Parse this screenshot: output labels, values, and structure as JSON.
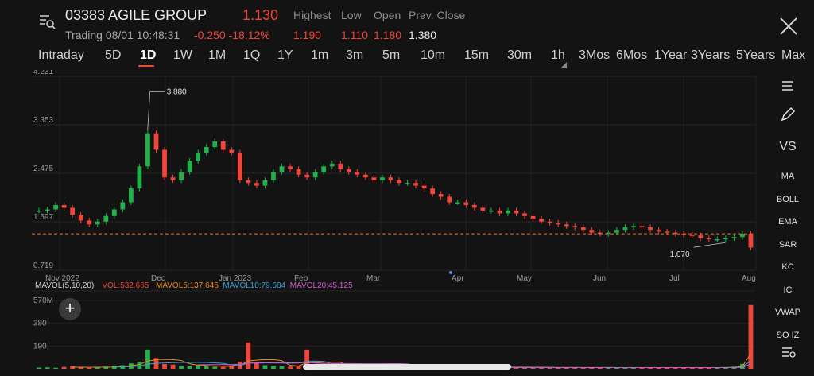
{
  "header": {
    "title": "03383 AGILE GROUP",
    "price": "1.130",
    "status": "Trading 08/01 10:48:31",
    "change": "-0.250  -18.12%",
    "stats": [
      {
        "label": "Highest",
        "value": "1.190"
      },
      {
        "label": "Low",
        "value": "1.110"
      },
      {
        "label": "Open",
        "value": "1.180"
      },
      {
        "label": "Prev. Close",
        "value": "1.380"
      }
    ]
  },
  "tabs": [
    "Intraday",
    "5D",
    "1D",
    "1W",
    "1M",
    "1Q",
    "1Y",
    "1m",
    "3m",
    "5m",
    "10m",
    "15m",
    "30m",
    "1h",
    "3Mos",
    "6Mos",
    "1Year",
    "3Years",
    "5Years",
    "Max"
  ],
  "active_tab": "1D",
  "tools": [
    "MA",
    "BOLL",
    "EMA",
    "SAR",
    "KC",
    "IC",
    "VWAP",
    "SO IZ"
  ],
  "tool_icons": [
    "list-lines-icon",
    "pencil-icon"
  ],
  "vs_label": "VS",
  "colors": {
    "up": "#22b04a",
    "down": "#f0453a",
    "prev_close": "#ef6a1a"
  },
  "chart_data": {
    "type": "candlestick",
    "y_ticks": [
      "4.231",
      "3.353",
      "2.475",
      "1.597",
      "0.719"
    ],
    "ylim": [
      0.719,
      4.231
    ],
    "x_ticks": [
      "Nov 2022",
      "Dec",
      "Jan 2023",
      "Feb",
      "Mar",
      "Apr",
      "May",
      "Jun",
      "Jul",
      "Aug"
    ],
    "high_label": "3.880",
    "low_label": "1.070",
    "prev_close": 1.38,
    "close_points": [
      1.8,
      1.82,
      1.9,
      1.85,
      1.72,
      1.62,
      1.55,
      1.6,
      1.7,
      1.82,
      1.95,
      2.2,
      2.6,
      3.2,
      2.9,
      2.4,
      2.35,
      2.5,
      2.7,
      2.85,
      2.95,
      3.05,
      2.9,
      2.85,
      2.35,
      2.3,
      2.25,
      2.35,
      2.5,
      2.6,
      2.55,
      2.45,
      2.4,
      2.5,
      2.6,
      2.65,
      2.55,
      2.5,
      2.45,
      2.4,
      2.35,
      2.4,
      2.35,
      2.3,
      2.3,
      2.25,
      2.2,
      2.1,
      2.05,
      1.95,
      1.95,
      1.9,
      1.85,
      1.8,
      1.8,
      1.75,
      1.8,
      1.75,
      1.7,
      1.65,
      1.6,
      1.58,
      1.55,
      1.52,
      1.5,
      1.45,
      1.4,
      1.38,
      1.4,
      1.45,
      1.5,
      1.52,
      1.5,
      1.45,
      1.42,
      1.4,
      1.38,
      1.36,
      1.35,
      1.3,
      1.28,
      1.28,
      1.3,
      1.32,
      1.38,
      1.13
    ],
    "volume": {
      "legend": [
        "MAVOL(5,10,20)",
        "VOL:532.665",
        "MAVOL5:137.645",
        "MAVOL10:79.684",
        "MAVOL20:45.125"
      ],
      "legend_colors": [
        "#d0d0d0",
        "#f0453a",
        "#ef8a1a",
        "#3a9ed8",
        "#d05ad0"
      ],
      "y_ticks": [
        "570M",
        "380",
        "190"
      ],
      "ylim": [
        0,
        570
      ],
      "values": [
        10,
        12,
        8,
        15,
        20,
        10,
        8,
        12,
        18,
        25,
        30,
        45,
        60,
        160,
        90,
        40,
        35,
        25,
        20,
        30,
        22,
        18,
        15,
        20,
        60,
        220,
        50,
        30,
        25,
        20,
        18,
        25,
        160,
        40,
        30,
        25,
        20,
        22,
        18,
        15,
        20,
        18,
        25,
        15,
        12,
        18,
        14,
        12,
        16,
        10,
        14,
        12,
        10,
        8,
        12,
        10,
        14,
        10,
        9,
        8,
        12,
        10,
        8,
        9,
        12,
        10,
        8,
        10,
        12,
        9,
        8,
        10,
        12,
        10,
        9,
        8,
        10,
        12,
        9,
        8,
        10,
        12,
        14,
        18,
        40,
        532
      ]
    }
  }
}
